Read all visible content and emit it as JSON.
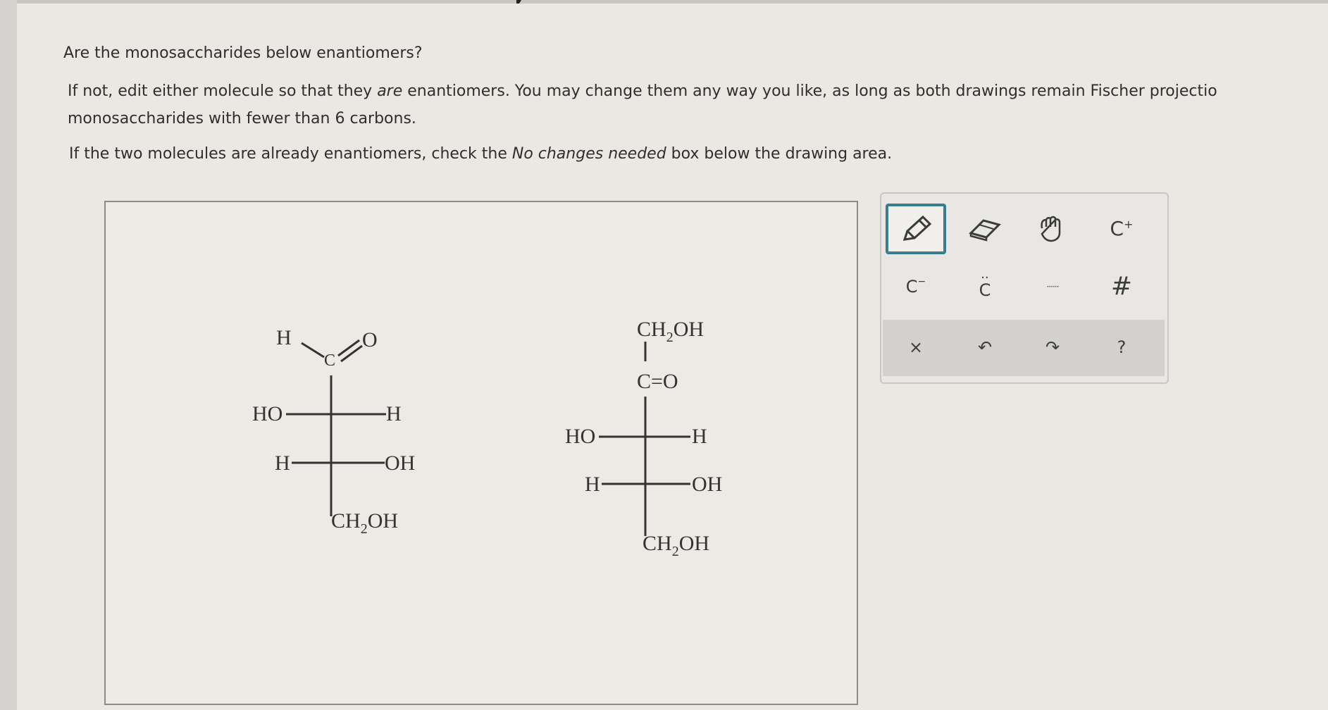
{
  "question": {
    "line1": "Are the monosaccharides below enantiomers?",
    "line2_prefix": "If not, edit either molecule so that they ",
    "line2_em": "are",
    "line2_suffix": " enantiomers. You may change them any way you like, as long as both drawings remain Fischer projectio",
    "line3": "monosaccharides with fewer than 6 carbons.",
    "line4_prefix": "If the two molecules are already enantiomers, check the ",
    "line4_em": "No changes needed",
    "line4_suffix": " box below the drawing area."
  },
  "molecule_left": {
    "top_h": "H",
    "top_c": "C",
    "top_o": "O",
    "row1_left": "HO",
    "row1_right": "H",
    "row2_left": "H",
    "row2_right": "OH",
    "bottom": "CH",
    "bottom_sub": "2",
    "bottom_tail": "OH"
  },
  "molecule_right": {
    "top": "CH",
    "top_sub": "2",
    "top_tail": "OH",
    "carbonyl": "C=O",
    "row1_left": "HO",
    "row1_right": "H",
    "row2_left": "H",
    "row2_right": "OH",
    "bottom": "CH",
    "bottom_sub": "2",
    "bottom_tail": "OH"
  },
  "toolbar": {
    "pencil": "pencil-icon",
    "eraser": "eraser-icon",
    "hand": "hand-icon",
    "cation_label": "C",
    "cation_sup": "+",
    "anion_label": "C",
    "anion_sup": "−",
    "lone_pair_label": "C",
    "lone_pair_dots": "··",
    "radical": "······",
    "isotope": "#",
    "clear": "×",
    "undo": "↶",
    "redo": "↷",
    "help": "?"
  },
  "colors": {
    "selected_border": "#3b7d90",
    "text": "#2e2e2e"
  }
}
